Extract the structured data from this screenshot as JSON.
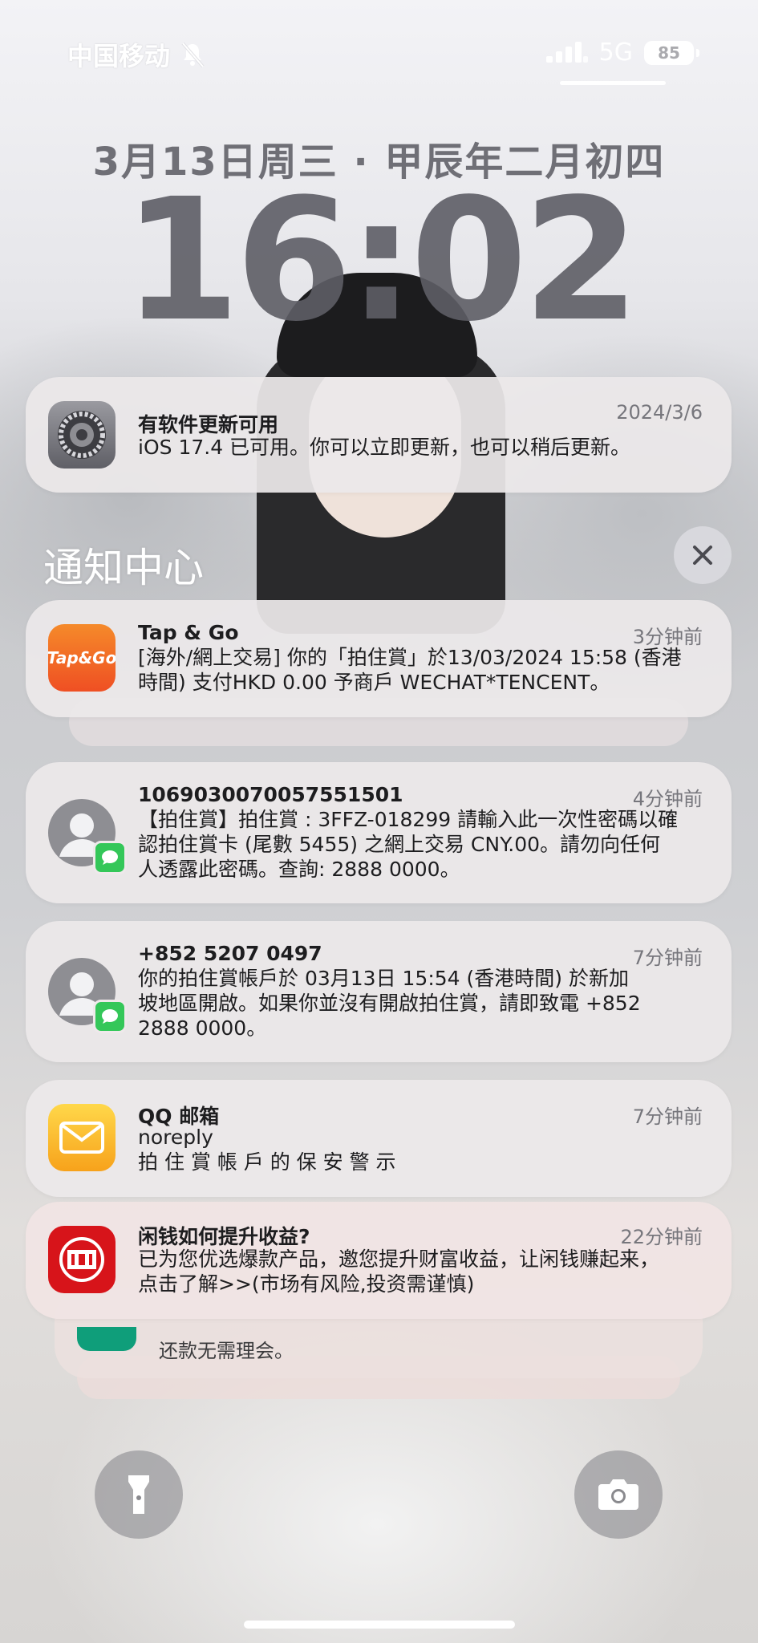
{
  "status_bar": {
    "carrier": "中国移动",
    "network": "5G",
    "battery": "85"
  },
  "lock_screen": {
    "date": "3月13日周三 · 甲辰年二月初四",
    "time": "16:02"
  },
  "notification_center": {
    "title": "通知中心"
  },
  "notifications": [
    {
      "app": "settings",
      "title": "有软件更新可用",
      "time": "2024/3/6",
      "body": "iOS 17.4 已可用。你可以立即更新，也可以稍后更新。"
    },
    {
      "app": "Tap & Go",
      "title": "Tap & Go",
      "time": "3分钟前",
      "body": "[海外/網上交易] 你的「拍住賞」於13/03/2024 15:58 (香港\n時間) 支付HKD 0.00 予商戶 WECHAT*TENCENT。",
      "icon_text": "Tap&Go"
    },
    {
      "app": "messages",
      "title": "1069030070057551501",
      "time": "4分钟前",
      "body": "【拍住賞】拍住賞 : 3FFZ-018299 請輸入此一次性密碼以確\n認拍住賞卡 (尾數 5455) 之網上交易 CNY.00。請勿向任何\n人透露此密碼。查詢:  2888 0000。"
    },
    {
      "app": "messages",
      "title": "+852 5207 0497",
      "time": "7分钟前",
      "body": "你的拍住賞帳戶於 03月13日 15:54 (香港時間) 於新加\n坡地區開啟。如果你並沒有開啟拍住賞，請即致電 +852\n2888 0000。"
    },
    {
      "app": "QQ邮箱",
      "title": "QQ 邮箱",
      "time": "7分钟前",
      "body": "noreply\n拍 住 賞 帳 戶 的 保 安 警 示"
    },
    {
      "app": "citic",
      "title": "闲钱如何提升收益?",
      "time": "22分钟前",
      "body": "已为您优选爆款产品，邀您提升财富收益，让闲钱赚起来，\n点击了解>>(市场有风险,投资需谨慎)"
    }
  ],
  "partial_notification_text": "还款无需理会。",
  "colors": {
    "tapgo": "#f26b21",
    "messages_badge": "#34c759",
    "qqmail": "#fdb813",
    "citic": "#d7141a"
  },
  "icons": [
    "bell-slash-icon",
    "signal-icon",
    "gear-icon",
    "person-icon",
    "message-bubble-icon",
    "mail-icon",
    "citic-logo-icon",
    "close-icon",
    "flashlight-icon",
    "camera-icon"
  ]
}
